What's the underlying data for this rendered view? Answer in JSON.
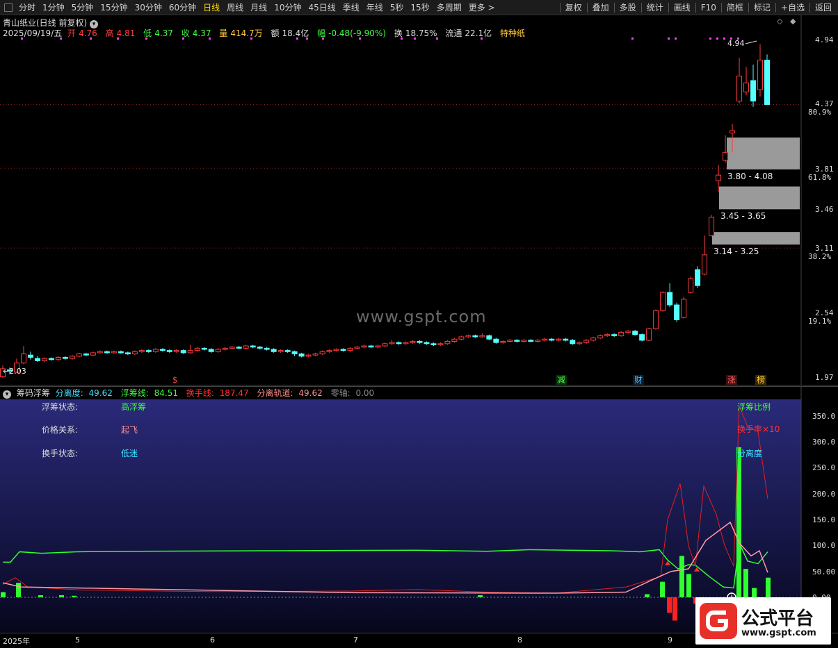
{
  "toolbar": {
    "left_items": [
      "分时",
      "1分钟",
      "5分钟",
      "15分钟",
      "30分钟",
      "60分钟",
      "日线",
      "周线",
      "月线",
      "10分钟",
      "45日线",
      "季线",
      "年线",
      "5秒",
      "15秒",
      "多周期",
      "更多 >"
    ],
    "active_index": 6,
    "right_items": [
      "复权",
      "叠加",
      "多股",
      "统计",
      "画线",
      "F10",
      "简框",
      "标记",
      "+自选",
      "返回"
    ]
  },
  "header": {
    "title": "青山纸业(日线 前复权)",
    "date": "2025/09/19/五",
    "open_label": "开",
    "open": "4.76",
    "high_label": "高",
    "high": "4.81",
    "low_label": "低",
    "low": "4.37",
    "close_label": "收",
    "close": "4.37",
    "vol_label": "量",
    "vol": "414.7万",
    "amt_label": "额",
    "amt": "18.4亿",
    "chg_label": "幅",
    "chg": "-0.48(-9.90%)",
    "turn_label": "换",
    "turn": "18.75%",
    "float_label": "流通",
    "float": "22.1亿",
    "tag": "特种纸"
  },
  "price_axis": [
    "4.94",
    "4.37",
    "3.81",
    "3.46",
    "3.11",
    "2.54",
    "1.97"
  ],
  "pct_axis": [
    "80.9%",
    "61.8%",
    "38.2%",
    "19.1%"
  ],
  "price_marks": {
    "high": "4.94",
    "low": "2.03"
  },
  "chip_zones": [
    "3.80 - 4.08",
    "3.45 - 3.65",
    "3.14 - 3.25"
  ],
  "events": [
    {
      "label": "$",
      "color": "#ff4040"
    },
    {
      "label": "减",
      "color": "#40ff40"
    },
    {
      "label": "财",
      "color": "#40c0ff"
    },
    {
      "label": "涨",
      "color": "#ff6060"
    },
    {
      "label": "榜",
      "color": "#ffcc40"
    }
  ],
  "watermark": "www.gspt.com",
  "indicator": {
    "name": "筹码浮筹",
    "legend": [
      {
        "label": "分离度:",
        "value": "49.62",
        "color": "#40e0ff"
      },
      {
        "label": "浮筹线:",
        "value": "84.51",
        "color": "#40ff40"
      },
      {
        "label": "换手线:",
        "value": "187.47",
        "color": "#ff3030"
      },
      {
        "label": "分离轨道:",
        "value": "49.62",
        "color": "#ff9090"
      },
      {
        "label": "零轴:",
        "value": "0.00",
        "color": "#888888"
      }
    ],
    "states": [
      {
        "label": "浮筹状态:",
        "value": "高浮筹",
        "color": "#40ff40"
      },
      {
        "label": "价格关系:",
        "value": "起飞",
        "color": "#ff9090"
      },
      {
        "label": "换手状态:",
        "value": "低迷",
        "color": "#40e0ff"
      }
    ],
    "right_labels": [
      {
        "text": "浮筹比例",
        "color": "#40ff40"
      },
      {
        "text": "换手率×10",
        "color": "#ff3030"
      },
      {
        "text": "分离度",
        "color": "#40e0ff"
      }
    ],
    "y_axis": [
      "350.0",
      "300.0",
      "250.0",
      "200.0",
      "150.0",
      "100.0",
      "50.00",
      "0.00"
    ]
  },
  "x_axis": [
    "2025年",
    "5",
    "6",
    "7",
    "8",
    "9"
  ],
  "logo": {
    "name": "公式平台",
    "url": "www.gspt.com"
  },
  "chart_data": {
    "type": "candlestick",
    "title": "青山纸业(日线 前复权)",
    "ylim": [
      1.97,
      4.94
    ],
    "candles": [
      [
        1.98,
        2.05,
        2.08,
        1.97
      ],
      [
        2.04,
        2.03,
        2.06,
        2.0
      ],
      [
        2.02,
        2.1,
        2.14,
        2.01
      ],
      [
        2.1,
        2.18,
        2.25,
        2.09
      ],
      [
        2.17,
        2.15,
        2.2,
        2.13
      ],
      [
        2.14,
        2.12,
        2.16,
        2.11
      ],
      [
        2.12,
        2.14,
        2.15,
        2.11
      ],
      [
        2.14,
        2.13,
        2.15,
        2.12
      ],
      [
        2.13,
        2.15,
        2.16,
        2.12
      ],
      [
        2.15,
        2.14,
        2.16,
        2.13
      ],
      [
        2.14,
        2.16,
        2.17,
        2.13
      ],
      [
        2.16,
        2.18,
        2.19,
        2.15
      ],
      [
        2.18,
        2.17,
        2.19,
        2.16
      ],
      [
        2.17,
        2.19,
        2.2,
        2.16
      ],
      [
        2.19,
        2.2,
        2.21,
        2.18
      ],
      [
        2.2,
        2.19,
        2.21,
        2.18
      ],
      [
        2.19,
        2.2,
        2.21,
        2.18
      ],
      [
        2.2,
        2.19,
        2.21,
        2.18
      ],
      [
        2.19,
        2.18,
        2.2,
        2.17
      ],
      [
        2.18,
        2.2,
        2.21,
        2.17
      ],
      [
        2.2,
        2.21,
        2.22,
        2.19
      ],
      [
        2.21,
        2.2,
        2.22,
        2.19
      ],
      [
        2.2,
        2.22,
        2.23,
        2.19
      ],
      [
        2.22,
        2.21,
        2.23,
        2.2
      ],
      [
        2.21,
        2.2,
        2.22,
        2.19
      ],
      [
        2.2,
        2.21,
        2.22,
        2.19
      ],
      [
        2.21,
        2.19,
        2.22,
        2.18
      ],
      [
        2.19,
        2.21,
        2.26,
        2.18
      ],
      [
        2.21,
        2.23,
        2.24,
        2.2
      ],
      [
        2.23,
        2.22,
        2.24,
        2.21
      ],
      [
        2.22,
        2.2,
        2.23,
        2.19
      ],
      [
        2.2,
        2.22,
        2.23,
        2.19
      ],
      [
        2.22,
        2.23,
        2.24,
        2.21
      ],
      [
        2.23,
        2.24,
        2.25,
        2.22
      ],
      [
        2.24,
        2.23,
        2.25,
        2.22
      ],
      [
        2.23,
        2.25,
        2.26,
        2.22
      ],
      [
        2.25,
        2.24,
        2.26,
        2.23
      ],
      [
        2.24,
        2.23,
        2.25,
        2.22
      ],
      [
        2.23,
        2.22,
        2.24,
        2.21
      ],
      [
        2.22,
        2.2,
        2.23,
        2.19
      ],
      [
        2.2,
        2.21,
        2.22,
        2.19
      ],
      [
        2.21,
        2.2,
        2.22,
        2.19
      ],
      [
        2.2,
        2.18,
        2.21,
        2.16
      ],
      [
        2.18,
        2.16,
        2.19,
        2.15
      ],
      [
        2.16,
        2.17,
        2.18,
        2.15
      ],
      [
        2.17,
        2.18,
        2.19,
        2.16
      ],
      [
        2.18,
        2.2,
        2.21,
        2.17
      ],
      [
        2.2,
        2.21,
        2.22,
        2.19
      ],
      [
        2.21,
        2.22,
        2.23,
        2.2
      ],
      [
        2.22,
        2.21,
        2.23,
        2.2
      ],
      [
        2.21,
        2.23,
        2.24,
        2.2
      ],
      [
        2.23,
        2.24,
        2.25,
        2.22
      ],
      [
        2.24,
        2.25,
        2.26,
        2.23
      ],
      [
        2.25,
        2.24,
        2.26,
        2.23
      ],
      [
        2.24,
        2.25,
        2.26,
        2.23
      ],
      [
        2.25,
        2.27,
        2.28,
        2.24
      ],
      [
        2.27,
        2.28,
        2.3,
        2.26
      ],
      [
        2.28,
        2.27,
        2.29,
        2.26
      ],
      [
        2.27,
        2.28,
        2.29,
        2.26
      ],
      [
        2.28,
        2.29,
        2.3,
        2.27
      ],
      [
        2.29,
        2.28,
        2.3,
        2.27
      ],
      [
        2.28,
        2.27,
        2.29,
        2.26
      ],
      [
        2.27,
        2.26,
        2.28,
        2.25
      ],
      [
        2.26,
        2.27,
        2.28,
        2.25
      ],
      [
        2.27,
        2.29,
        2.3,
        2.26
      ],
      [
        2.29,
        2.31,
        2.32,
        2.28
      ],
      [
        2.31,
        2.33,
        2.34,
        2.3
      ],
      [
        2.33,
        2.34,
        2.35,
        2.32
      ],
      [
        2.34,
        2.33,
        2.35,
        2.32
      ],
      [
        2.33,
        2.34,
        2.36,
        2.32
      ],
      [
        2.34,
        2.31,
        2.35,
        2.3
      ],
      [
        2.31,
        2.28,
        2.32,
        2.27
      ],
      [
        2.28,
        2.29,
        2.3,
        2.27
      ],
      [
        2.29,
        2.3,
        2.31,
        2.28
      ],
      [
        2.3,
        2.29,
        2.31,
        2.28
      ],
      [
        2.29,
        2.3,
        2.31,
        2.28
      ],
      [
        2.3,
        2.29,
        2.31,
        2.28
      ],
      [
        2.29,
        2.3,
        2.31,
        2.28
      ],
      [
        2.3,
        2.31,
        2.32,
        2.29
      ],
      [
        2.31,
        2.3,
        2.32,
        2.29
      ],
      [
        2.3,
        2.31,
        2.32,
        2.29
      ],
      [
        2.31,
        2.3,
        2.32,
        2.29
      ],
      [
        2.3,
        2.27,
        2.31,
        2.26
      ],
      [
        2.27,
        2.28,
        2.29,
        2.26
      ],
      [
        2.28,
        2.3,
        2.31,
        2.27
      ],
      [
        2.3,
        2.32,
        2.33,
        2.29
      ],
      [
        2.32,
        2.34,
        2.35,
        2.31
      ],
      [
        2.34,
        2.35,
        2.36,
        2.33
      ],
      [
        2.35,
        2.34,
        2.36,
        2.33
      ],
      [
        2.34,
        2.37,
        2.38,
        2.33
      ],
      [
        2.37,
        2.38,
        2.39,
        2.36
      ],
      [
        2.38,
        2.35,
        2.39,
        2.34
      ],
      [
        2.35,
        2.3,
        2.36,
        2.29
      ],
      [
        2.3,
        2.4,
        2.41,
        2.29
      ],
      [
        2.4,
        2.56,
        2.57,
        2.39
      ],
      [
        2.56,
        2.72,
        2.73,
        2.55
      ],
      [
        2.72,
        2.61,
        2.8,
        2.59
      ],
      [
        2.61,
        2.48,
        2.63,
        2.46
      ],
      [
        2.5,
        2.66,
        2.68,
        2.49
      ],
      [
        2.72,
        2.84,
        2.86,
        2.71
      ],
      [
        2.92,
        2.78,
        2.95,
        2.76
      ],
      [
        2.88,
        3.05,
        3.22,
        2.87
      ],
      [
        3.22,
        3.38,
        3.4,
        3.21
      ],
      [
        3.7,
        3.75,
        3.84,
        3.6
      ],
      [
        3.88,
        3.95,
        4.1,
        3.86
      ],
      [
        4.12,
        4.14,
        4.2,
        3.95
      ],
      [
        4.4,
        4.62,
        4.78,
        4.38
      ],
      [
        4.48,
        4.56,
        4.7,
        4.45
      ],
      [
        4.58,
        4.4,
        4.72,
        4.35
      ],
      [
        4.5,
        4.76,
        4.9,
        4.44
      ],
      [
        4.76,
        4.37,
        4.81,
        4.37
      ]
    ]
  }
}
